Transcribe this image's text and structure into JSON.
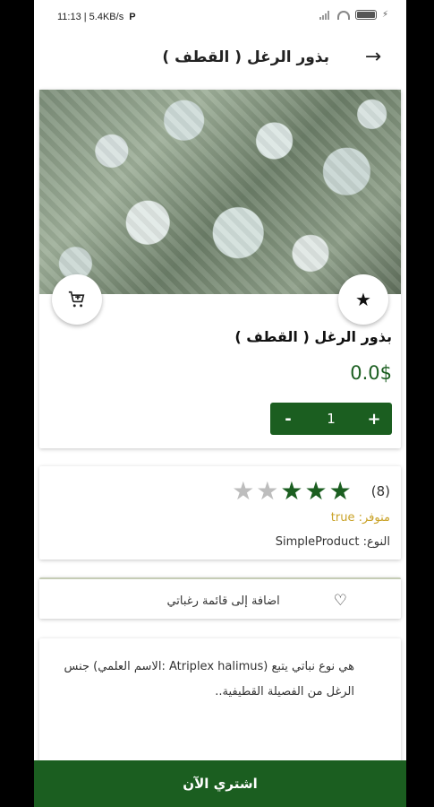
{
  "status_bar": {
    "time": "11:13 | 5.4KB/s",
    "app_icon": "P"
  },
  "header": {
    "title": "بذور الرغل ( القطف )",
    "back_icon": "arrow-right-icon"
  },
  "product": {
    "name": "بذور الرغل ( القطف )",
    "price": "0.0$",
    "quantity": "1",
    "decrement_label": "-",
    "increment_label": "+",
    "cart_icon": "add-to-cart-icon",
    "favorite_icon": "star-icon"
  },
  "rating": {
    "count": "(8)",
    "score": 3,
    "max": 5,
    "availability_label": "متوفر:",
    "availability_value": "true",
    "type_label": "النوع:",
    "type_value": "SimpleProduct"
  },
  "wishlist": {
    "label": "اضافة إلى قائمة رغباتي",
    "icon": "heart-icon"
  },
  "description": {
    "text": "هي نوع نباتي يتبع (Atriplex halimus :الاسم العلمي) جنس الرغل من الفصيلة القطيفية.."
  },
  "footer": {
    "buy_label": "اشتري الآن"
  },
  "colors": {
    "primary": "#1b5e20",
    "availability": "#c9a227",
    "star_off": "#bdbdbd"
  }
}
